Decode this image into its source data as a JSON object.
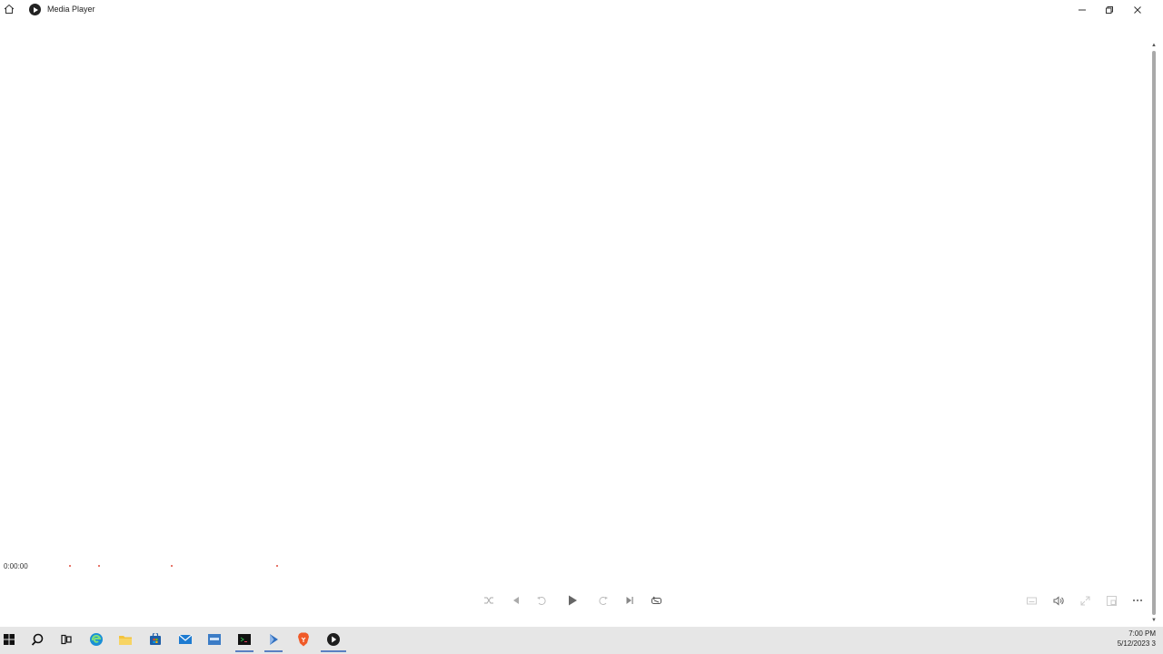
{
  "window": {
    "title": "Media Player"
  },
  "player": {
    "elapsed": "0:00:00"
  },
  "taskbar": {
    "time": "7:00 PM",
    "date": "5/12/2023",
    "overflow_char": "3"
  }
}
